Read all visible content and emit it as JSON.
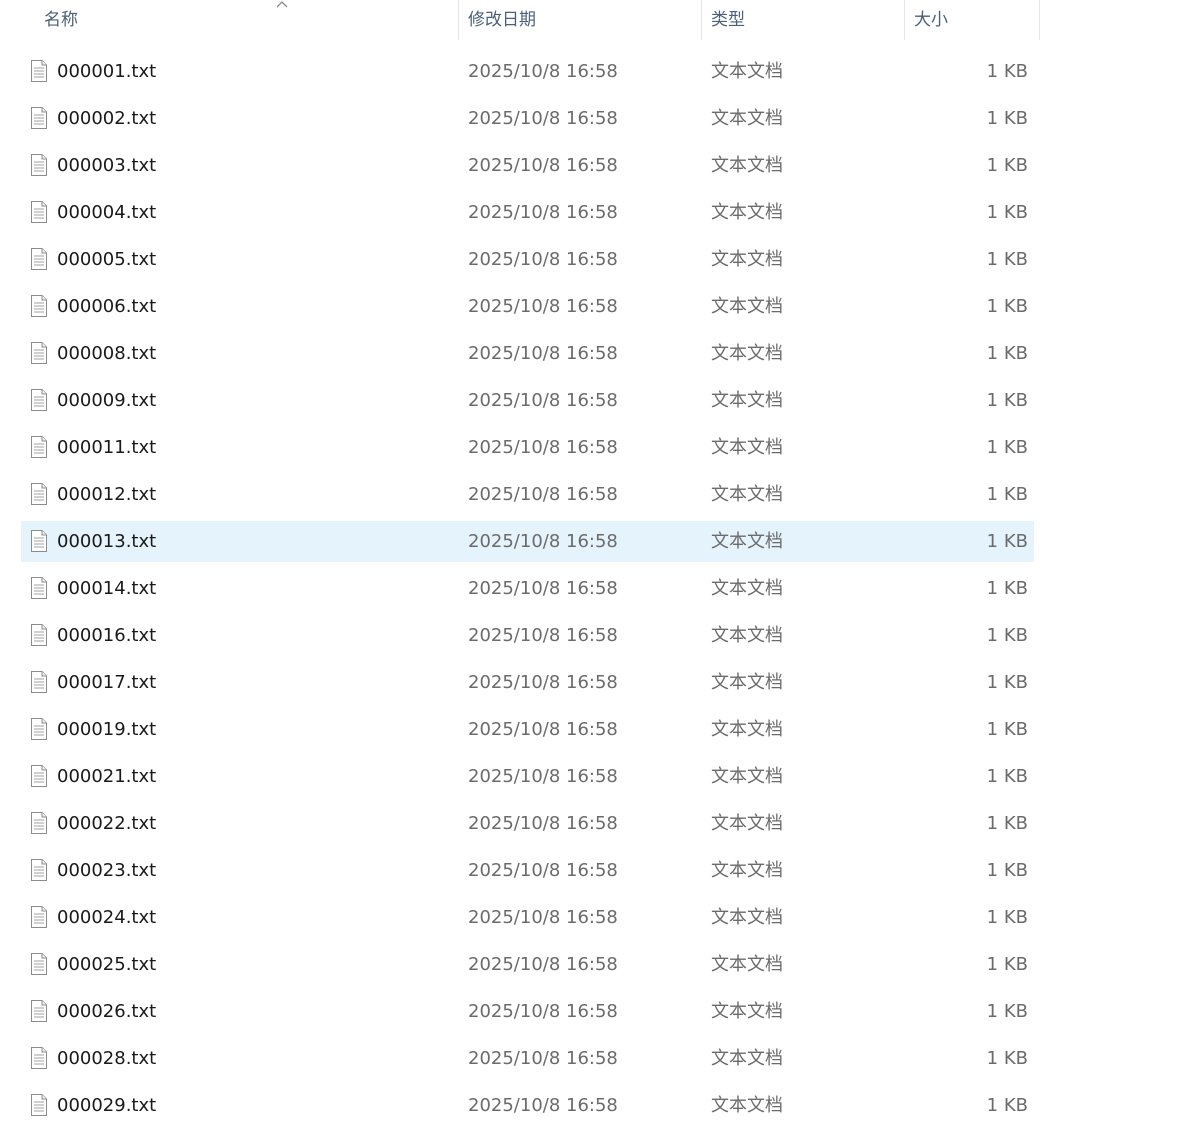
{
  "columns": {
    "name": "名称",
    "date": "修改日期",
    "type": "类型",
    "size": "大小"
  },
  "sort": {
    "column": "name",
    "direction": "ascending",
    "icon": "sort-ascending-chevron-icon"
  },
  "selected_index": 10,
  "files": [
    {
      "name": "000001.txt",
      "date": "2025/10/8 16:58",
      "type": "文本文档",
      "size": "1 KB",
      "icon": "text-file-icon"
    },
    {
      "name": "000002.txt",
      "date": "2025/10/8 16:58",
      "type": "文本文档",
      "size": "1 KB",
      "icon": "text-file-icon"
    },
    {
      "name": "000003.txt",
      "date": "2025/10/8 16:58",
      "type": "文本文档",
      "size": "1 KB",
      "icon": "text-file-icon"
    },
    {
      "name": "000004.txt",
      "date": "2025/10/8 16:58",
      "type": "文本文档",
      "size": "1 KB",
      "icon": "text-file-icon"
    },
    {
      "name": "000005.txt",
      "date": "2025/10/8 16:58",
      "type": "文本文档",
      "size": "1 KB",
      "icon": "text-file-icon"
    },
    {
      "name": "000006.txt",
      "date": "2025/10/8 16:58",
      "type": "文本文档",
      "size": "1 KB",
      "icon": "text-file-icon"
    },
    {
      "name": "000008.txt",
      "date": "2025/10/8 16:58",
      "type": "文本文档",
      "size": "1 KB",
      "icon": "text-file-icon"
    },
    {
      "name": "000009.txt",
      "date": "2025/10/8 16:58",
      "type": "文本文档",
      "size": "1 KB",
      "icon": "text-file-icon"
    },
    {
      "name": "000011.txt",
      "date": "2025/10/8 16:58",
      "type": "文本文档",
      "size": "1 KB",
      "icon": "text-file-icon"
    },
    {
      "name": "000012.txt",
      "date": "2025/10/8 16:58",
      "type": "文本文档",
      "size": "1 KB",
      "icon": "text-file-icon"
    },
    {
      "name": "000013.txt",
      "date": "2025/10/8 16:58",
      "type": "文本文档",
      "size": "1 KB",
      "icon": "text-file-icon"
    },
    {
      "name": "000014.txt",
      "date": "2025/10/8 16:58",
      "type": "文本文档",
      "size": "1 KB",
      "icon": "text-file-icon"
    },
    {
      "name": "000016.txt",
      "date": "2025/10/8 16:58",
      "type": "文本文档",
      "size": "1 KB",
      "icon": "text-file-icon"
    },
    {
      "name": "000017.txt",
      "date": "2025/10/8 16:58",
      "type": "文本文档",
      "size": "1 KB",
      "icon": "text-file-icon"
    },
    {
      "name": "000019.txt",
      "date": "2025/10/8 16:58",
      "type": "文本文档",
      "size": "1 KB",
      "icon": "text-file-icon"
    },
    {
      "name": "000021.txt",
      "date": "2025/10/8 16:58",
      "type": "文本文档",
      "size": "1 KB",
      "icon": "text-file-icon"
    },
    {
      "name": "000022.txt",
      "date": "2025/10/8 16:58",
      "type": "文本文档",
      "size": "1 KB",
      "icon": "text-file-icon"
    },
    {
      "name": "000023.txt",
      "date": "2025/10/8 16:58",
      "type": "文本文档",
      "size": "1 KB",
      "icon": "text-file-icon"
    },
    {
      "name": "000024.txt",
      "date": "2025/10/8 16:58",
      "type": "文本文档",
      "size": "1 KB",
      "icon": "text-file-icon"
    },
    {
      "name": "000025.txt",
      "date": "2025/10/8 16:58",
      "type": "文本文档",
      "size": "1 KB",
      "icon": "text-file-icon"
    },
    {
      "name": "000026.txt",
      "date": "2025/10/8 16:58",
      "type": "文本文档",
      "size": "1 KB",
      "icon": "text-file-icon"
    },
    {
      "name": "000028.txt",
      "date": "2025/10/8 16:58",
      "type": "文本文档",
      "size": "1 KB",
      "icon": "text-file-icon"
    },
    {
      "name": "000029.txt",
      "date": "2025/10/8 16:58",
      "type": "文本文档",
      "size": "1 KB",
      "icon": "text-file-icon"
    }
  ]
}
